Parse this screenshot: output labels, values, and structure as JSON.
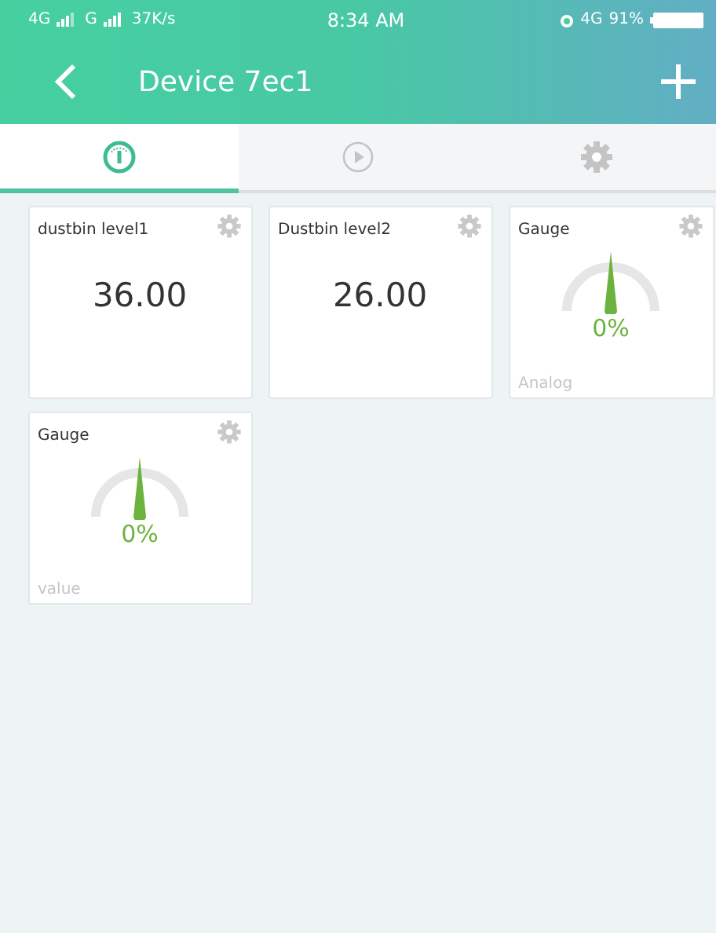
{
  "status_bar": {
    "network_1": "4G",
    "network_2": "G",
    "speed": "37K/s",
    "time": "8:34 AM",
    "network_3": "4G",
    "battery": "91%"
  },
  "header": {
    "title": "Device 7ec1"
  },
  "tabs": [
    {
      "kind": "gauge",
      "selected": true
    },
    {
      "kind": "play",
      "selected": false
    },
    {
      "kind": "settings",
      "selected": false
    }
  ],
  "widgets": [
    {
      "kind": "value",
      "title": "dustbin level1",
      "value": "36.00"
    },
    {
      "kind": "value",
      "title": "Dustbin level2",
      "value": "26.00"
    },
    {
      "kind": "gauge",
      "title": "Gauge",
      "reading": "0%",
      "caption": "Analog"
    },
    {
      "kind": "gauge",
      "title": "Gauge",
      "reading": "0%",
      "caption": "value"
    }
  ]
}
